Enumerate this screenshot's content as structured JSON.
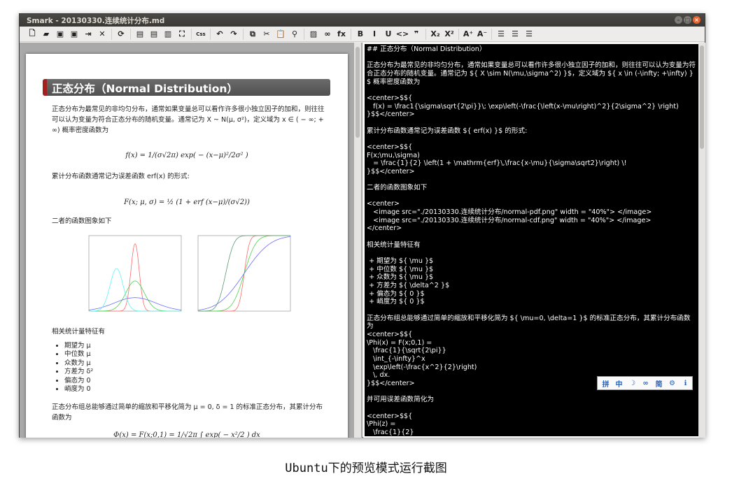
{
  "window": {
    "title": "Smark - 20130330.连续统计分布.md",
    "controls": [
      "minimize",
      "maximize",
      "close"
    ]
  },
  "toolbar": [
    {
      "icon": "new-file-icon",
      "glyph": "🗋"
    },
    {
      "icon": "open-folder-icon",
      "glyph": "▰"
    },
    {
      "icon": "save-icon",
      "glyph": "▣"
    },
    {
      "icon": "save-as-icon",
      "glyph": "▣"
    },
    {
      "icon": "export-icon",
      "glyph": "⇥"
    },
    {
      "icon": "close-icon",
      "glyph": "✕"
    },
    {
      "sep": true
    },
    {
      "icon": "refresh-icon",
      "glyph": "⟳"
    },
    {
      "sep": true
    },
    {
      "icon": "editor-view-icon",
      "glyph": "▤"
    },
    {
      "icon": "preview-view-icon",
      "glyph": "▤"
    },
    {
      "icon": "split-view-icon",
      "glyph": "▥"
    },
    {
      "icon": "fullscreen-icon",
      "glyph": "⛶"
    },
    {
      "sep": true
    },
    {
      "icon": "css-icon",
      "glyph": "Css"
    },
    {
      "sep": true
    },
    {
      "icon": "undo-icon",
      "glyph": "↶"
    },
    {
      "icon": "redo-icon",
      "glyph": "↷"
    },
    {
      "sep": true
    },
    {
      "icon": "copy-icon",
      "glyph": "⧉"
    },
    {
      "icon": "cut-icon",
      "glyph": "✂"
    },
    {
      "icon": "paste-icon",
      "glyph": "📋"
    },
    {
      "icon": "find-icon",
      "glyph": "⚲"
    },
    {
      "sep": true
    },
    {
      "icon": "image-icon",
      "glyph": "▨"
    },
    {
      "icon": "link-icon",
      "glyph": "∞"
    },
    {
      "icon": "formula-icon",
      "glyph": "fx"
    },
    {
      "sep": true
    },
    {
      "icon": "bold-icon",
      "glyph": "B"
    },
    {
      "icon": "italic-icon",
      "glyph": "I"
    },
    {
      "icon": "underline-icon",
      "glyph": "U"
    },
    {
      "icon": "code-icon",
      "glyph": "<>"
    },
    {
      "icon": "quote-icon",
      "glyph": "❞"
    },
    {
      "sep": true
    },
    {
      "icon": "subscript-icon",
      "glyph": "X₂"
    },
    {
      "icon": "superscript-icon",
      "glyph": "X²"
    },
    {
      "sep": true
    },
    {
      "icon": "font-increase-icon",
      "glyph": "A⁺"
    },
    {
      "icon": "font-decrease-icon",
      "glyph": "A⁻"
    },
    {
      "sep": true
    },
    {
      "icon": "align-left-icon",
      "glyph": "☰"
    },
    {
      "icon": "align-center-icon",
      "glyph": "☰"
    },
    {
      "icon": "align-right-icon",
      "glyph": "☰"
    }
  ],
  "preview": {
    "heading": "正态分布（Normal Distribution）",
    "para1": "正态分布为最常见的非均匀分布，通常如果变量总可以看作许多很小独立因子的加和，则往往可以认为变量为符合正态分布的随机变量。通常记为 X ~ N(μ, σ²)，定义域为 x ∈ ( − ∞; + ∞) 概率密度函数为",
    "formula1": "f(x) = 1/(σ√2π) exp( − (x−μ)²/2σ² )",
    "para2": "累计分布函数通常记为误差函数 erf(x) 的形式:",
    "formula2": "F(x; μ, σ) = ½ (1 + erf (x−μ)/(σ√2))",
    "para3": "二者的函数图象如下",
    "para4": "相关统计量特征有",
    "list": [
      "期望为 μ",
      "中位数 μ",
      "众数为 μ",
      "方差为 δ²",
      "偏态为 0",
      "峭度为 0"
    ],
    "para5": "正态分布组总能够通过简单的缩放和平移化简为 μ = 0, δ = 1 的标准正态分布，其累计分布函数为",
    "formula3": "Φ(x) = F(x;0,1) = 1/√2π ∫ exp( − x²/2 ) dx",
    "colors": {
      "red": "#ff6a6a",
      "green": "#4fd14f",
      "blue": "#6a6aff",
      "cyan": "#5ff5f5",
      "dark_green": "#5a9a70"
    }
  },
  "editor": {
    "lines": [
      "## 正态分布（Normal Distribution）",
      "",
      "正态分布为最常见的非均匀分布，通常如果变量总可以看作许多很小独立因子的加和，则往往可以认为变量为符合正态分布的随机变量。通常记为 ${ X \\sim N(\\mu,\\sigma^2) }$，定义域为 ${ x \\in (-\\infty; +\\infty) }$ 概率密度函数为",
      "",
      "<center>$${",
      "   f(x) = \\frac1{\\sigma\\sqrt{2\\pi}}\\; \\exp\\left(-\\frac{\\left(x-\\mu\\right)^2}{2\\sigma^2} \\right)",
      "}$$</center>",
      "",
      "累计分布函数通常记为误差函数 ${ erf(x) }$ 的形式:",
      "",
      "<center>$${",
      "F(x;\\mu,\\sigma)",
      "   = \\frac{1}{2} \\left(1 + \\mathrm{erf}\\,\\frac{x-\\mu}{\\sigma\\sqrt2}\\right) \\!",
      "}$$</center>",
      "",
      "二者的函数图象如下",
      "",
      "<center>",
      "   <image src=\"./20130330.连续统计分布/normal-pdf.png\" width = \"40%\"> </image>",
      "   <image src=\"./20130330.连续统计分布/normal-cdf.png\" width = \"40%\"> </image>",
      "</center>",
      "",
      "相关统计量特征有",
      "",
      " + 期望为 ${ \\mu }$",
      " + 中位数 ${ \\mu }$",
      " + 众数为 ${ \\mu }$",
      " + 方差为 ${ \\delta^2 }$",
      " + 偏态为 ${ 0 }$",
      " + 峭度为 ${ 0 }$",
      "",
      "正态分布组总能够通过简单的缩放和平移化简为 ${ \\mu=0, \\delta=1 }$ 的标准正态分布，其累计分布函数为",
      "<center>$${",
      "\\Phi(x) = F(x;0,1) =",
      "   \\frac{1}{\\sqrt{2\\pi}}",
      "   \\int_{-\\infty}^x",
      "   \\exp\\left(-\\frac{x^2}{2}\\right)",
      "   \\, dx.",
      "}$$</center>",
      "",
      "并可用误差函数简化为",
      "",
      "<center>$${",
      "\\Phi(z) =",
      "   \\frac{1}{2}"
    ]
  },
  "ime_toolbar": [
    {
      "icon": "pinyin-icon",
      "glyph": "拼"
    },
    {
      "icon": "chinese-mode-icon",
      "glyph": "中"
    },
    {
      "icon": "half-width-icon",
      "glyph": "☽"
    },
    {
      "icon": "punctuation-icon",
      "glyph": "∞"
    },
    {
      "icon": "simplified-icon",
      "glyph": "简"
    },
    {
      "icon": "settings-icon",
      "glyph": "⚙"
    },
    {
      "icon": "info-icon",
      "glyph": "ℹ"
    }
  ],
  "caption": "Ubuntu下的预览模式运行截图"
}
